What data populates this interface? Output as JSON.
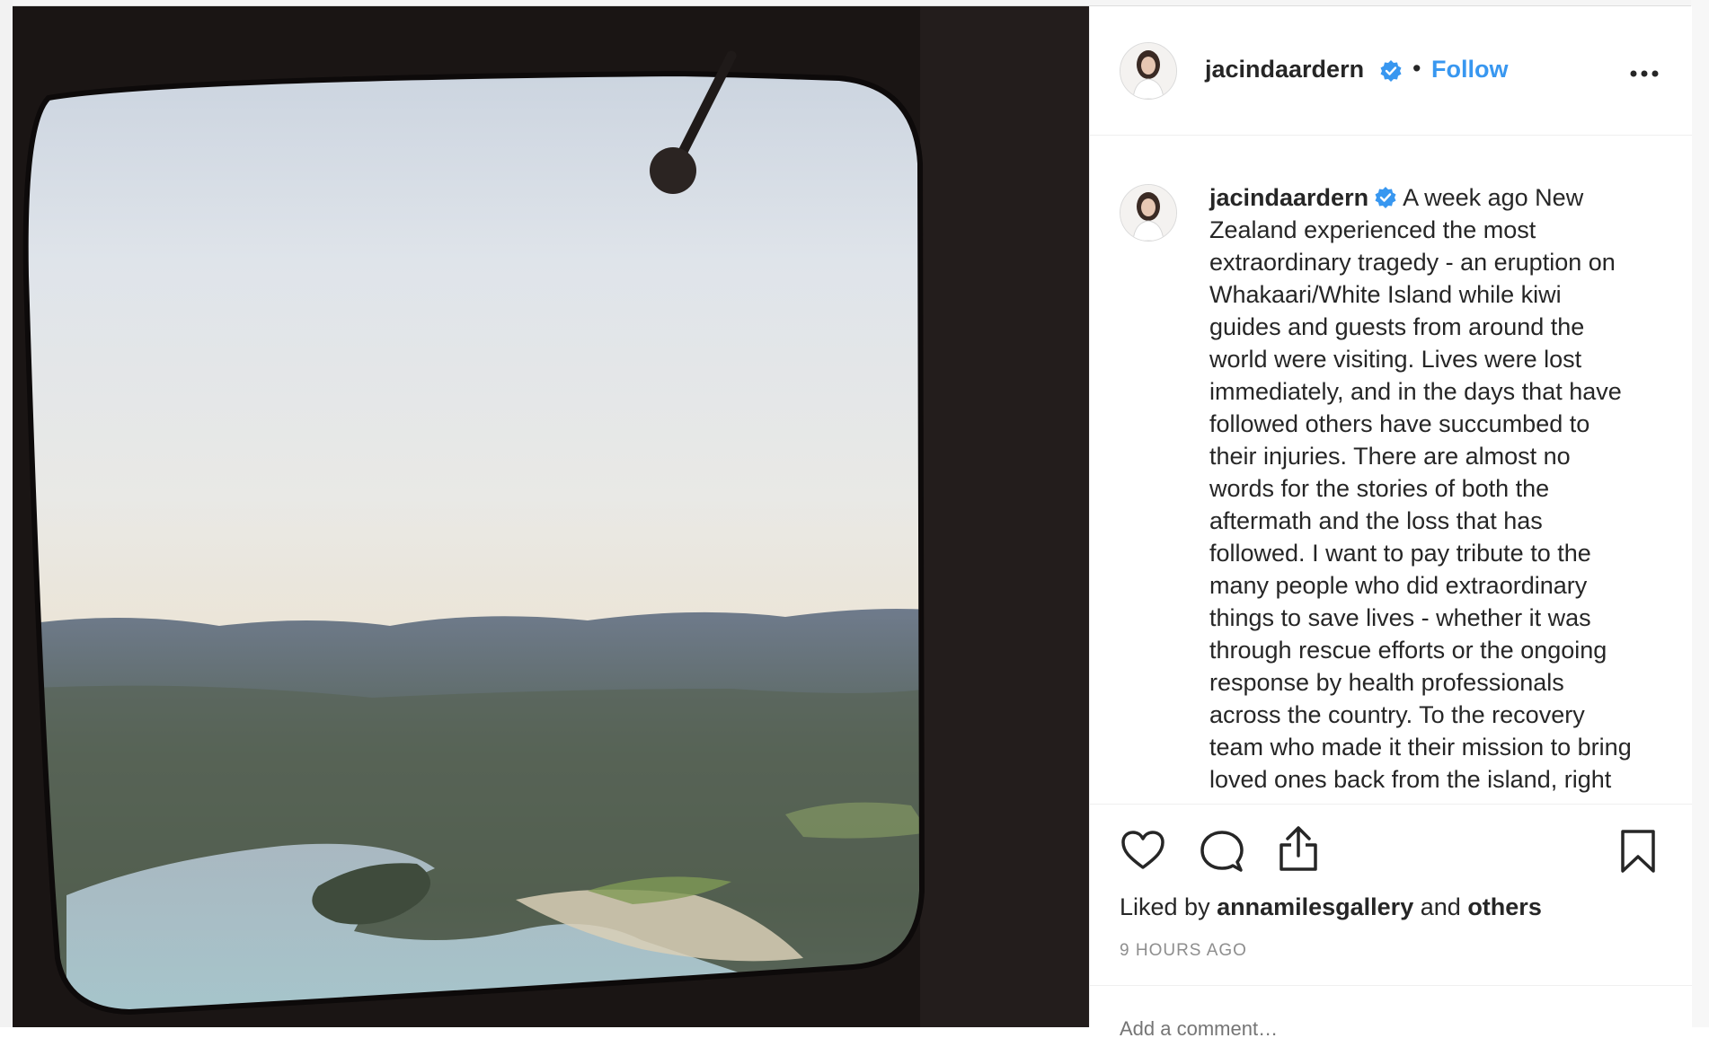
{
  "post": {
    "author": "jacindaardern",
    "follow_label": "Follow",
    "separator": "•",
    "caption_lines": [
      "Zealand experienced the most",
      "extraordinary tragedy - an eruption on",
      "Whakaari/White Island while kiwi",
      "guides and guests from around the",
      "world were visiting. Lives were lost",
      "immediately, and in the days that have",
      "followed others have succumbed to",
      "their injuries. There are almost no",
      "words for the stories of both the",
      "aftermath and the loss that has",
      "followed. I want to pay tribute to the",
      "many people who did extraordinary",
      "things to save lives - whether it was",
      "through rescue efforts or the ongoing",
      "response by health professionals",
      "across the country. To the recovery",
      "team who made it their mission to bring",
      "loved ones back from the island, right"
    ],
    "caption_first_line": "A week ago New",
    "likes": {
      "prefix": "Liked by",
      "user": "annamilesgallery",
      "conjunction": "and",
      "others": "others"
    },
    "timestamp": "9 HOURS AGO",
    "comment_placeholder": "Add a comment…"
  },
  "icons": {
    "verified": "verified-badge-icon",
    "more": "more-options-icon",
    "like": "heart-icon",
    "comment": "comment-icon",
    "share": "share-icon",
    "save": "bookmark-icon"
  },
  "colors": {
    "link_blue": "#3897f0",
    "verified_blue": "#3897f0",
    "text": "#262626",
    "muted": "#8e8e8e",
    "border": "#efefef"
  }
}
